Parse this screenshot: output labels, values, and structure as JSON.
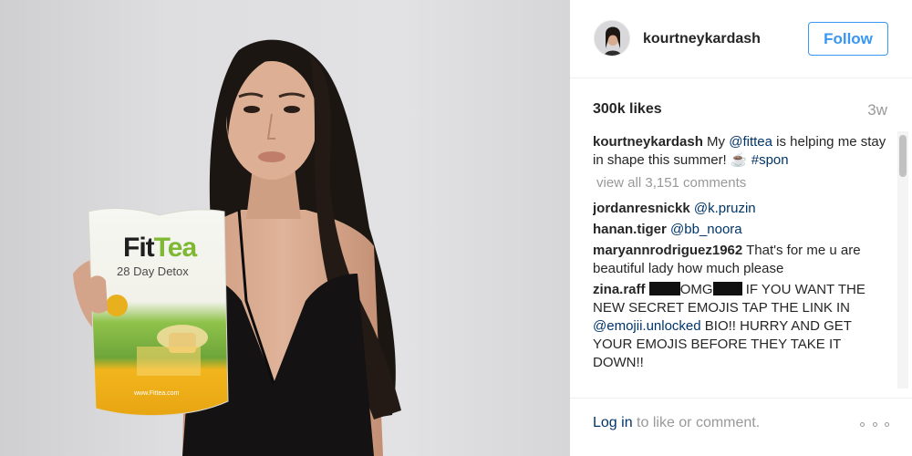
{
  "post": {
    "username": "kourtneykardash",
    "follow_label": "Follow",
    "likes": "300k likes",
    "time_ago": "3w",
    "caption": {
      "user": "kourtneykardash",
      "text_before": " My ",
      "mention": "@fittea",
      "text_after": " is helping me stay in shape this summer! ☕ ",
      "hashtag": "#spon"
    },
    "view_all_comments": "view all 3,151 comments",
    "comments": [
      {
        "user": "jordanresnickk",
        "mention": "@k.pruzin"
      },
      {
        "user": "hanan.tiger",
        "mention": "@bb_noora"
      },
      {
        "user": "maryannrodriguez1962",
        "text": " That's for me u are beautiful lady how much please"
      }
    ],
    "spam_comment": {
      "user": "zina.raff",
      "omg": "OMG",
      "text_1": " IF YOU WANT THE NEW SECRET EMOJIS TAP THE LINK IN ",
      "mention": "@emojii.unlocked",
      "text_2": " BIO!! HURRY AND GET YOUR EMOJIS BEFORE THEY TAKE IT DOWN!!"
    },
    "footer": {
      "login_link": "Log in",
      "login_rest": " to like or comment."
    }
  },
  "product": {
    "brand_fit": "Fit",
    "brand_tea": "Tea",
    "brand_sub": "28 Day Detox",
    "url": "www.Fittea.com"
  },
  "colors": {
    "link_blue": "#003569",
    "button_blue": "#3897f0",
    "muted_gray": "#999999",
    "text_dark": "#262626"
  },
  "icons": {
    "more": "more-options-icon"
  }
}
